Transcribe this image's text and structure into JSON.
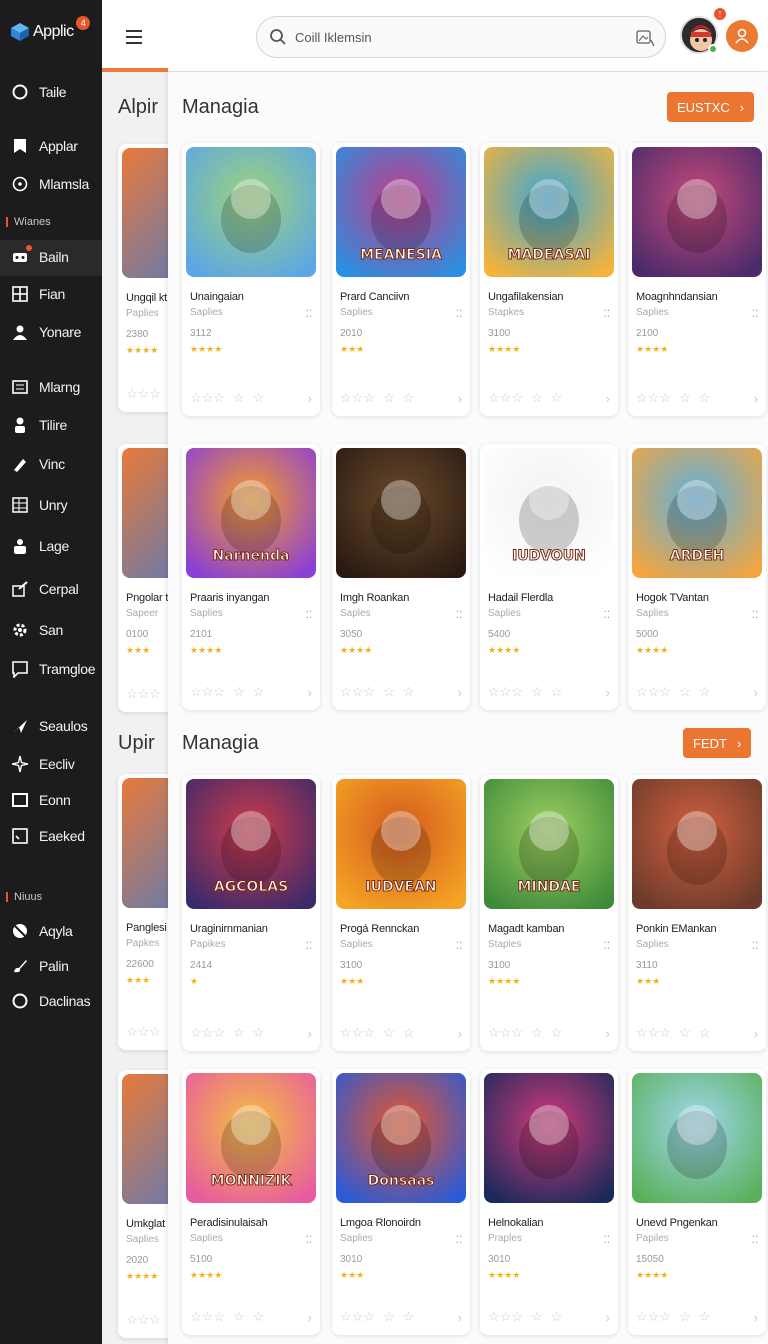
{
  "app": {
    "name": "Applic",
    "badge": "4"
  },
  "sidebar": {
    "items": [
      {
        "label": "Taile",
        "icon": "refresh-icon"
      },
      {
        "label": "Applar",
        "icon": "bookmark-icon"
      },
      {
        "label": "Mlamsla",
        "icon": "compass-icon"
      },
      {
        "label": "Bailn",
        "icon": "gamepad-icon"
      },
      {
        "label": "Fian",
        "icon": "grid-icon"
      },
      {
        "label": "Yonare",
        "icon": "user-icon"
      },
      {
        "label": "Mlarng",
        "icon": "list-icon"
      },
      {
        "label": "Tilire",
        "icon": "person-icon"
      },
      {
        "label": "Vinc",
        "icon": "pen-icon"
      },
      {
        "label": "Unry",
        "icon": "table-icon"
      },
      {
        "label": "Lage",
        "icon": "profile-icon"
      },
      {
        "label": "Cerpal",
        "icon": "share-icon"
      },
      {
        "label": "San",
        "icon": "gear-icon"
      },
      {
        "label": "Tramgloe",
        "icon": "chat-icon"
      },
      {
        "label": "Seaulos",
        "icon": "send-icon"
      },
      {
        "label": "Eecliv",
        "icon": "sparkle-icon"
      },
      {
        "label": "Eonn",
        "icon": "window-icon"
      },
      {
        "label": "Eaeked",
        "icon": "check-box-icon"
      },
      {
        "label": "Aqyla",
        "icon": "no-entry-icon"
      },
      {
        "label": "Palin",
        "icon": "brush-icon"
      },
      {
        "label": "Daclinas",
        "icon": "circle-icon"
      }
    ],
    "headers": [
      "Wianes",
      "Niuus"
    ]
  },
  "search": {
    "placeholder": "Coill Iklemsin"
  },
  "user": {
    "notif": "!"
  },
  "leftcol": {
    "sections": [
      "Alpir",
      "Upir"
    ]
  },
  "sections": [
    {
      "title": "Managia",
      "button": "EUSTXC"
    },
    {
      "title": "Managia",
      "button": "FEDT"
    }
  ],
  "partial_cards": [
    {
      "title": "Ungqil kt",
      "sub": "Paplies",
      "count": "2380",
      "stars": "★★★★"
    },
    {
      "title": "Pngolar t",
      "sub": "Sapeer",
      "count": "0100",
      "stars": "★★★"
    },
    {
      "title": "Panglesi",
      "sub": "Papkes",
      "count": "22600",
      "stars": "★★★"
    },
    {
      "title": "Umkglat",
      "sub": "Saplies",
      "count": "2020",
      "stars": "★★★★"
    }
  ],
  "cards": [
    {
      "title": "Unaingaian",
      "sub": "Saplies",
      "count": "3112",
      "stars": "★★★★",
      "name_art": "",
      "colors": [
        "#5aa6e6",
        "#9fd37a"
      ]
    },
    {
      "title": "Prard Canciivn",
      "sub": "Saplies",
      "count": "2010",
      "stars": "★★★",
      "name_art": "MEANESIA",
      "colors": [
        "#2a8fe0",
        "#c23c8a"
      ]
    },
    {
      "title": "Ungafilakensian",
      "sub": "Stapkes",
      "count": "3100",
      "stars": "★★★★",
      "name_art": "MADEASAI",
      "colors": [
        "#f6b33b",
        "#37a7d8"
      ]
    },
    {
      "title": "Moagnhndansian",
      "sub": "Saplies",
      "count": "2100",
      "stars": "★★★★",
      "name_art": "",
      "colors": [
        "#4a2a6a",
        "#c64a7a"
      ]
    },
    {
      "title": "Praaris inyangan",
      "sub": "Saplies",
      "count": "2101",
      "stars": "★★★★",
      "name_art": "Narnenda",
      "colors": [
        "#8a3fd6",
        "#f59c2a"
      ]
    },
    {
      "title": "Imgh Roankan",
      "sub": "Saples",
      "count": "3050",
      "stars": "★★★★",
      "name_art": "",
      "colors": [
        "#2a1a12",
        "#6a4a2a"
      ]
    },
    {
      "title": "Hadail Flerdla",
      "sub": "Saplies",
      "count": "5400",
      "stars": "★★★★",
      "name_art": "IUDVOUN",
      "colors": [
        "#ffffff",
        "#f2f2f2"
      ]
    },
    {
      "title": "Hogok TVantan",
      "sub": "Saplies",
      "count": "5000",
      "stars": "★★★★",
      "name_art": "ARDEH",
      "colors": [
        "#f2a540",
        "#5db1e0"
      ]
    },
    {
      "title": "Uraginirnmanian",
      "sub": "Papikes",
      "count": "2414",
      "stars": "★",
      "name_art": "AGCOLAS",
      "colors": [
        "#3a2a6a",
        "#d13a4a"
      ]
    },
    {
      "title": "Progá Rennckan",
      "sub": "Saplies",
      "count": "3100",
      "stars": "★★★",
      "name_art": "IUDVEAN",
      "colors": [
        "#f5a524",
        "#d2591f"
      ]
    },
    {
      "title": "Magadt kamban",
      "sub": "Stapies",
      "count": "3100",
      "stars": "★★★★",
      "name_art": "MINDAE",
      "colors": [
        "#3f8a3a",
        "#9fd060"
      ]
    },
    {
      "title": "Ponkin EMankan",
      "sub": "Saplies",
      "count": "3110",
      "stars": "★★★",
      "name_art": "",
      "colors": [
        "#6a3a2a",
        "#d26040"
      ]
    },
    {
      "title": "Peradisinulaisah",
      "sub": "Saplies",
      "count": "5100",
      "stars": "★★★★",
      "name_art": "MONNIZIK",
      "colors": [
        "#e85aa0",
        "#f4c040"
      ]
    },
    {
      "title": "Lmgoa Rlonoirdn",
      "sub": "Saplies",
      "count": "3010",
      "stars": "★★★",
      "name_art": "Donsaas",
      "colors": [
        "#2a5ad6",
        "#e8562a"
      ]
    },
    {
      "title": "Helnokalian",
      "sub": "Praples",
      "count": "3010",
      "stars": "★★★★",
      "name_art": "",
      "colors": [
        "#1a2a5a",
        "#d23a7a"
      ]
    },
    {
      "title": "Unevd Pngenkan",
      "sub": "Papiles",
      "count": "15050",
      "stars": "★★★★",
      "name_art": "",
      "colors": [
        "#5ab05a",
        "#a0d8f0"
      ]
    }
  ]
}
